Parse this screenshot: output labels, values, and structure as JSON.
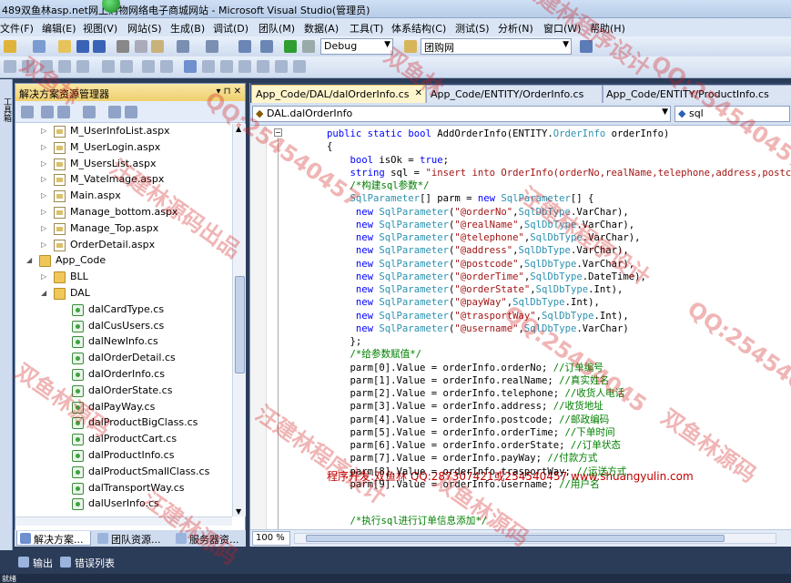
{
  "window": {
    "title": "489双鱼林asp.net网上购物网络电子商城网站 - Microsoft Visual Studio(管理员)"
  },
  "menu": [
    "文件(F)",
    "编辑(E)",
    "视图(V)",
    "网站(S)",
    "生成(B)",
    "调试(D)",
    "团队(M)",
    "数据(A)",
    "工具(T)",
    "体系结构(C)",
    "测试(S)",
    "分析(N)",
    "窗口(W)",
    "帮助(H)"
  ],
  "toolbar": {
    "config_value": "Debug",
    "find_value": "团购网"
  },
  "left_strip": {
    "label": "工具箱"
  },
  "solution_explorer": {
    "title": "解决方案资源管理器",
    "pin_glyphs": "▾ ⊓ ✕",
    "tree": [
      {
        "label": "M_UserInfoList.aspx",
        "type": "page",
        "expander": "▷"
      },
      {
        "label": "M_UserLogin.aspx",
        "type": "page",
        "expander": "▷"
      },
      {
        "label": "M_UsersList.aspx",
        "type": "page",
        "expander": "▷"
      },
      {
        "label": "M_VateImage.aspx",
        "type": "page",
        "expander": "▷"
      },
      {
        "label": "Main.aspx",
        "type": "page",
        "expander": "▷"
      },
      {
        "label": "Manage_bottom.aspx",
        "type": "page",
        "expander": "▷"
      },
      {
        "label": "Manage_Top.aspx",
        "type": "page",
        "expander": "▷"
      },
      {
        "label": "OrderDetail.aspx",
        "type": "page",
        "expander": "▷"
      },
      {
        "label": "App_Code",
        "type": "folder",
        "expander": "◢"
      },
      {
        "label": "BLL",
        "type": "folder",
        "expander": "▷"
      },
      {
        "label": "DAL",
        "type": "folder",
        "expander": "◢"
      },
      {
        "label": "dalCardType.cs",
        "type": "cs",
        "expander": ""
      },
      {
        "label": "dalCusUsers.cs",
        "type": "cs",
        "expander": ""
      },
      {
        "label": "dalNewInfo.cs",
        "type": "cs",
        "expander": ""
      },
      {
        "label": "dalOrderDetail.cs",
        "type": "cs",
        "expander": ""
      },
      {
        "label": "dalOrderInfo.cs",
        "type": "cs",
        "expander": ""
      },
      {
        "label": "dalOrderState.cs",
        "type": "cs",
        "expander": ""
      },
      {
        "label": "dalPayWay.cs",
        "type": "cs",
        "expander": ""
      },
      {
        "label": "dalProductBigClass.cs",
        "type": "cs",
        "expander": ""
      },
      {
        "label": "dalProductCart.cs",
        "type": "cs",
        "expander": ""
      },
      {
        "label": "dalProductInfo.cs",
        "type": "cs",
        "expander": ""
      },
      {
        "label": "dalProductSmallClass.cs",
        "type": "cs",
        "expander": ""
      },
      {
        "label": "dalTransportWay.cs",
        "type": "cs",
        "expander": ""
      },
      {
        "label": "dalUserInfo.cs",
        "type": "cs",
        "expander": ""
      }
    ]
  },
  "pane_tabs": [
    "解决方案...",
    "团队资源...",
    "服务器资..."
  ],
  "editor": {
    "tabs": [
      "App_Code/DAL/dalOrderInfo.cs",
      "App_Code/ENTITY/OrderInfo.cs",
      "App_Code/ENTITY/ProductInfo.cs"
    ],
    "tab_close": "✕",
    "class_combo": "DAL.dalOrderInfo",
    "member_combo": "sql",
    "zoom": "100 %",
    "promo": "程序开发:双鱼林 QQ:287307421或254540457 www.shuangyulin.com",
    "code_lines": [
      [
        [
          "kw",
          "public"
        ],
        [
          "",
          " "
        ],
        [
          "kw",
          "static"
        ],
        [
          "",
          " "
        ],
        [
          "kw",
          "bool"
        ],
        [
          "",
          " AddOrderInfo(ENTITY."
        ],
        [
          "ty",
          "OrderInfo"
        ],
        [
          "",
          " orderInfo)"
        ]
      ],
      [
        [
          "",
          "{"
        ]
      ],
      [
        [
          "",
          "    "
        ],
        [
          "kw",
          "bool"
        ],
        [
          "",
          " isOk = "
        ],
        [
          "kw",
          "true"
        ],
        [
          "",
          ";"
        ]
      ],
      [
        [
          "",
          "    "
        ],
        [
          "kw",
          "string"
        ],
        [
          "",
          " sql = "
        ],
        [
          "st",
          "\"insert into OrderInfo(orderNo,realName,telephone,address,postcode"
        ]
      ],
      [
        [
          "",
          "    "
        ],
        [
          "cm",
          "/*构建sql参数*/"
        ]
      ],
      [
        [
          "",
          "    "
        ],
        [
          "ty",
          "SqlParameter"
        ],
        [
          "",
          "[] parm = "
        ],
        [
          "kw",
          "new"
        ],
        [
          "",
          " "
        ],
        [
          "ty",
          "SqlParameter"
        ],
        [
          "",
          "[] {"
        ]
      ],
      [
        [
          "",
          "     "
        ],
        [
          "kw",
          "new"
        ],
        [
          "",
          " "
        ],
        [
          "ty",
          "SqlParameter"
        ],
        [
          "",
          "("
        ],
        [
          "st",
          "\"@orderNo\""
        ],
        [
          "",
          ","
        ],
        [
          "ty",
          "SqlDbType"
        ],
        [
          "",
          ".VarChar),"
        ]
      ],
      [
        [
          "",
          "     "
        ],
        [
          "kw",
          "new"
        ],
        [
          "",
          " "
        ],
        [
          "ty",
          "SqlParameter"
        ],
        [
          "",
          "("
        ],
        [
          "st",
          "\"@realName\""
        ],
        [
          "",
          ","
        ],
        [
          "ty",
          "SqlDbType"
        ],
        [
          "",
          ".VarChar),"
        ]
      ],
      [
        [
          "",
          "     "
        ],
        [
          "kw",
          "new"
        ],
        [
          "",
          " "
        ],
        [
          "ty",
          "SqlParameter"
        ],
        [
          "",
          "("
        ],
        [
          "st",
          "\"@telephone\""
        ],
        [
          "",
          ","
        ],
        [
          "ty",
          "SqlDbType"
        ],
        [
          "",
          ".VarChar),"
        ]
      ],
      [
        [
          "",
          "     "
        ],
        [
          "kw",
          "new"
        ],
        [
          "",
          " "
        ],
        [
          "ty",
          "SqlParameter"
        ],
        [
          "",
          "("
        ],
        [
          "st",
          "\"@address\""
        ],
        [
          "",
          ","
        ],
        [
          "ty",
          "SqlDbType"
        ],
        [
          "",
          ".VarChar),"
        ]
      ],
      [
        [
          "",
          "     "
        ],
        [
          "kw",
          "new"
        ],
        [
          "",
          " "
        ],
        [
          "ty",
          "SqlParameter"
        ],
        [
          "",
          "("
        ],
        [
          "st",
          "\"@postcode\""
        ],
        [
          "",
          ","
        ],
        [
          "ty",
          "SqlDbType"
        ],
        [
          "",
          ".VarChar),"
        ]
      ],
      [
        [
          "",
          "     "
        ],
        [
          "kw",
          "new"
        ],
        [
          "",
          " "
        ],
        [
          "ty",
          "SqlParameter"
        ],
        [
          "",
          "("
        ],
        [
          "st",
          "\"@orderTime\""
        ],
        [
          "",
          ","
        ],
        [
          "ty",
          "SqlDbType"
        ],
        [
          "",
          ".DateTime),"
        ]
      ],
      [
        [
          "",
          "     "
        ],
        [
          "kw",
          "new"
        ],
        [
          "",
          " "
        ],
        [
          "ty",
          "SqlParameter"
        ],
        [
          "",
          "("
        ],
        [
          "st",
          "\"@orderState\""
        ],
        [
          "",
          ","
        ],
        [
          "ty",
          "SqlDbType"
        ],
        [
          "",
          ".Int),"
        ]
      ],
      [
        [
          "",
          "     "
        ],
        [
          "kw",
          "new"
        ],
        [
          "",
          " "
        ],
        [
          "ty",
          "SqlParameter"
        ],
        [
          "",
          "("
        ],
        [
          "st",
          "\"@payWay\""
        ],
        [
          "",
          ","
        ],
        [
          "ty",
          "SqlDbType"
        ],
        [
          "",
          ".Int),"
        ]
      ],
      [
        [
          "",
          "     "
        ],
        [
          "kw",
          "new"
        ],
        [
          "",
          " "
        ],
        [
          "ty",
          "SqlParameter"
        ],
        [
          "",
          "("
        ],
        [
          "st",
          "\"@trasportWay\""
        ],
        [
          "",
          ","
        ],
        [
          "ty",
          "SqlDbType"
        ],
        [
          "",
          ".Int),"
        ]
      ],
      [
        [
          "",
          "     "
        ],
        [
          "kw",
          "new"
        ],
        [
          "",
          " "
        ],
        [
          "ty",
          "SqlParameter"
        ],
        [
          "",
          "("
        ],
        [
          "st",
          "\"@username\""
        ],
        [
          "",
          ","
        ],
        [
          "ty",
          "SqlDbType"
        ],
        [
          "",
          ".VarChar)"
        ]
      ],
      [
        [
          "",
          "    };"
        ]
      ],
      [
        [
          "",
          "    "
        ],
        [
          "cm",
          "/*给参数赋值*/"
        ]
      ],
      [
        [
          "",
          "    parm[0].Value = orderInfo.orderNo; "
        ],
        [
          "cm",
          "//订单编号"
        ]
      ],
      [
        [
          "",
          "    parm[1].Value = orderInfo.realName; "
        ],
        [
          "cm",
          "//真实姓名"
        ]
      ],
      [
        [
          "",
          "    parm[2].Value = orderInfo.telephone; "
        ],
        [
          "cm",
          "//收货人电话"
        ]
      ],
      [
        [
          "",
          "    parm[3].Value = orderInfo.address; "
        ],
        [
          "cm",
          "//收货地址"
        ]
      ],
      [
        [
          "",
          "    parm[4].Value = orderInfo.postcode; "
        ],
        [
          "cm",
          "//邮政编码"
        ]
      ],
      [
        [
          "",
          "    parm[5].Value = orderInfo.orderTime; "
        ],
        [
          "cm",
          "//下单时间"
        ]
      ],
      [
        [
          "",
          "    parm[6].Value = orderInfo.orderState; "
        ],
        [
          "cm",
          "//订单状态"
        ]
      ],
      [
        [
          "",
          "    parm[7].Value = orderInfo.payWay; "
        ],
        [
          "cm",
          "//付款方式"
        ]
      ],
      [
        [
          "",
          "    parm[8].Value = orderInfo.trasportWay; "
        ],
        [
          "cm",
          "//运送方式"
        ]
      ],
      [
        [
          "",
          "    parm[9].Value = orderInfo.username; "
        ],
        [
          "cm",
          "//用户名"
        ]
      ],
      [
        [
          "",
          ""
        ]
      ],
      [
        [
          "",
          "    "
        ],
        [
          "cm",
          "/*执行sql进行订单信息添加*/"
        ]
      ]
    ]
  },
  "bottom_tabs": [
    "输出",
    "错误列表"
  ],
  "status": {
    "text": "就绪"
  },
  "watermarks": [
    "双鱼林",
    "汪建林程序设计",
    "QQ:254540457",
    "双鱼林源码",
    "汪建林源码出品",
    "双鱼林",
    "QQ:254540457",
    "汪建林程序设计",
    "QQ:25454045",
    "双鱼林源码",
    "汪建林程序设计",
    "QQ:254540457",
    "双鱼林源码",
    "汪建林源码"
  ],
  "colors": {
    "keyword": "#0000ff",
    "type": "#2b91af",
    "string": "#a31515",
    "comment": "#008000",
    "promo": "#c00000"
  }
}
